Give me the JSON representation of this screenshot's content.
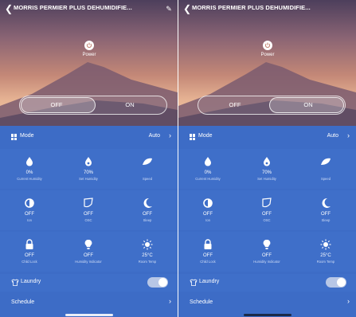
{
  "screens": [
    {
      "title": "MORRIS PERMIER PLUS DEHUMIDIFIE...",
      "power_label": "Power",
      "toggle": {
        "off_label": "OFF",
        "on_label": "ON",
        "selected": "OFF"
      },
      "mode": {
        "label": "Mode",
        "value": "Auto"
      },
      "tiles": [
        {
          "icon": "humidity-icon",
          "value": "0%",
          "label": "Current Humidity"
        },
        {
          "icon": "water-drop-icon",
          "value": "70%",
          "label": "Set Humidity"
        },
        {
          "icon": "fan-icon",
          "value": "",
          "label": "Speed"
        },
        {
          "icon": "ion-icon",
          "value": "OFF",
          "label": "Ion"
        },
        {
          "icon": "swing-icon",
          "value": "OFF",
          "label": "OSC"
        },
        {
          "icon": "moon-icon",
          "value": "OFF",
          "label": "Sleep"
        },
        {
          "icon": "lock-icon",
          "value": "OFF",
          "label": "Child Lock"
        },
        {
          "icon": "bulb-icon",
          "value": "OFF",
          "label": "Humidity Indicator"
        },
        {
          "icon": "sun-icon",
          "value": "25°C",
          "label": "Room Temp"
        }
      ],
      "laundry": {
        "label": "Laundry",
        "enabled": false
      },
      "schedule": {
        "label": "Schedule"
      }
    },
    {
      "title": "MORRIS PERMIER PLUS DEHUMIDIFIE...",
      "power_label": "Power",
      "toggle": {
        "off_label": "OFF",
        "on_label": "ON",
        "selected": "ON"
      },
      "mode": {
        "label": "Mode",
        "value": "Auto"
      },
      "tiles": [
        {
          "icon": "humidity-icon",
          "value": "0%",
          "label": "Current Humidity"
        },
        {
          "icon": "water-drop-icon",
          "value": "70%",
          "label": "Set Humidity"
        },
        {
          "icon": "fan-icon",
          "value": "",
          "label": "Speed"
        },
        {
          "icon": "ion-icon",
          "value": "OFF",
          "label": "Ion"
        },
        {
          "icon": "swing-icon",
          "value": "OFF",
          "label": "OSC"
        },
        {
          "icon": "moon-icon",
          "value": "OFF",
          "label": "Sleep"
        },
        {
          "icon": "lock-icon",
          "value": "OFF",
          "label": "Child Lock"
        },
        {
          "icon": "bulb-icon",
          "value": "OFF",
          "label": "Humidity Indicator"
        },
        {
          "icon": "sun-icon",
          "value": "25°C",
          "label": "Room Temp"
        }
      ],
      "laundry": {
        "label": "Laundry",
        "enabled": false
      },
      "schedule": {
        "label": "Schedule"
      }
    }
  ],
  "colors": {
    "panel": "#3d6cc6",
    "tile": "#3f6fc9",
    "accent": "#ffffff"
  }
}
